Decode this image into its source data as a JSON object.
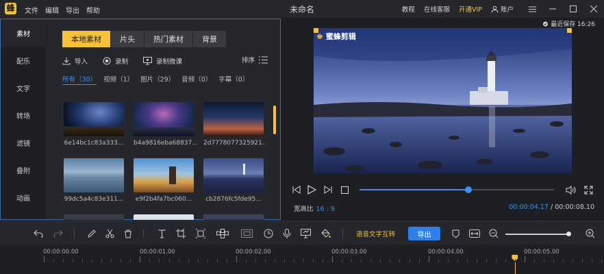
{
  "app": {
    "logo_char": "蜂",
    "title": "未命名"
  },
  "menu": [
    "文件",
    "编辑",
    "导出",
    "帮助"
  ],
  "topbar": {
    "tutorial": "教程",
    "support": "在线客服",
    "vip": "开通VIP",
    "account": "账户"
  },
  "side_tabs": [
    "素材",
    "配乐",
    "文字",
    "转场",
    "滤镜",
    "叠附",
    "动画"
  ],
  "library": {
    "tabs": [
      "本地素材",
      "片头",
      "热门素材",
      "背景"
    ],
    "actions": {
      "import": "导入",
      "record": "录制",
      "record_lesson": "录制微课",
      "sort": "排序"
    },
    "filters": [
      "所有（30）",
      "视频（1）",
      "图片（29）",
      "音频（0）",
      "字幕（0）"
    ],
    "items": [
      {
        "caption": "6e14bc1c83a333..."
      },
      {
        "caption": "b4a9816eba68837..."
      },
      {
        "caption": "2d7778077325921..."
      },
      {
        "caption": "99dc5a4c83e311..."
      },
      {
        "caption": "e9f2b4fa7bc060..."
      },
      {
        "caption": "cb2876fc5fde95..."
      }
    ]
  },
  "preview": {
    "saved": "最近保存 16:26",
    "watermark": "蜜蜂剪辑",
    "aspect_label": "宽高比",
    "aspect_value": "16 : 9",
    "current_time": "00:00:04.17",
    "total_time": "/ 00:00:08.10",
    "progress": 0.56
  },
  "toolbar": {
    "speech_to_text": "语音文字互转",
    "export": "导出",
    "zoom": 0.99
  },
  "ruler": {
    "labels": [
      "00:00:00.00",
      "00:00:01.00",
      "00:00:02.00",
      "00:00:03.00",
      "00:00:04.00",
      "00:00:05.00"
    ],
    "playhead_seconds": 4.9
  },
  "colors": {
    "accent": "#f7c23a",
    "blue": "#3a8ff0",
    "panel": "#26272c",
    "background": "#1b1c20"
  }
}
